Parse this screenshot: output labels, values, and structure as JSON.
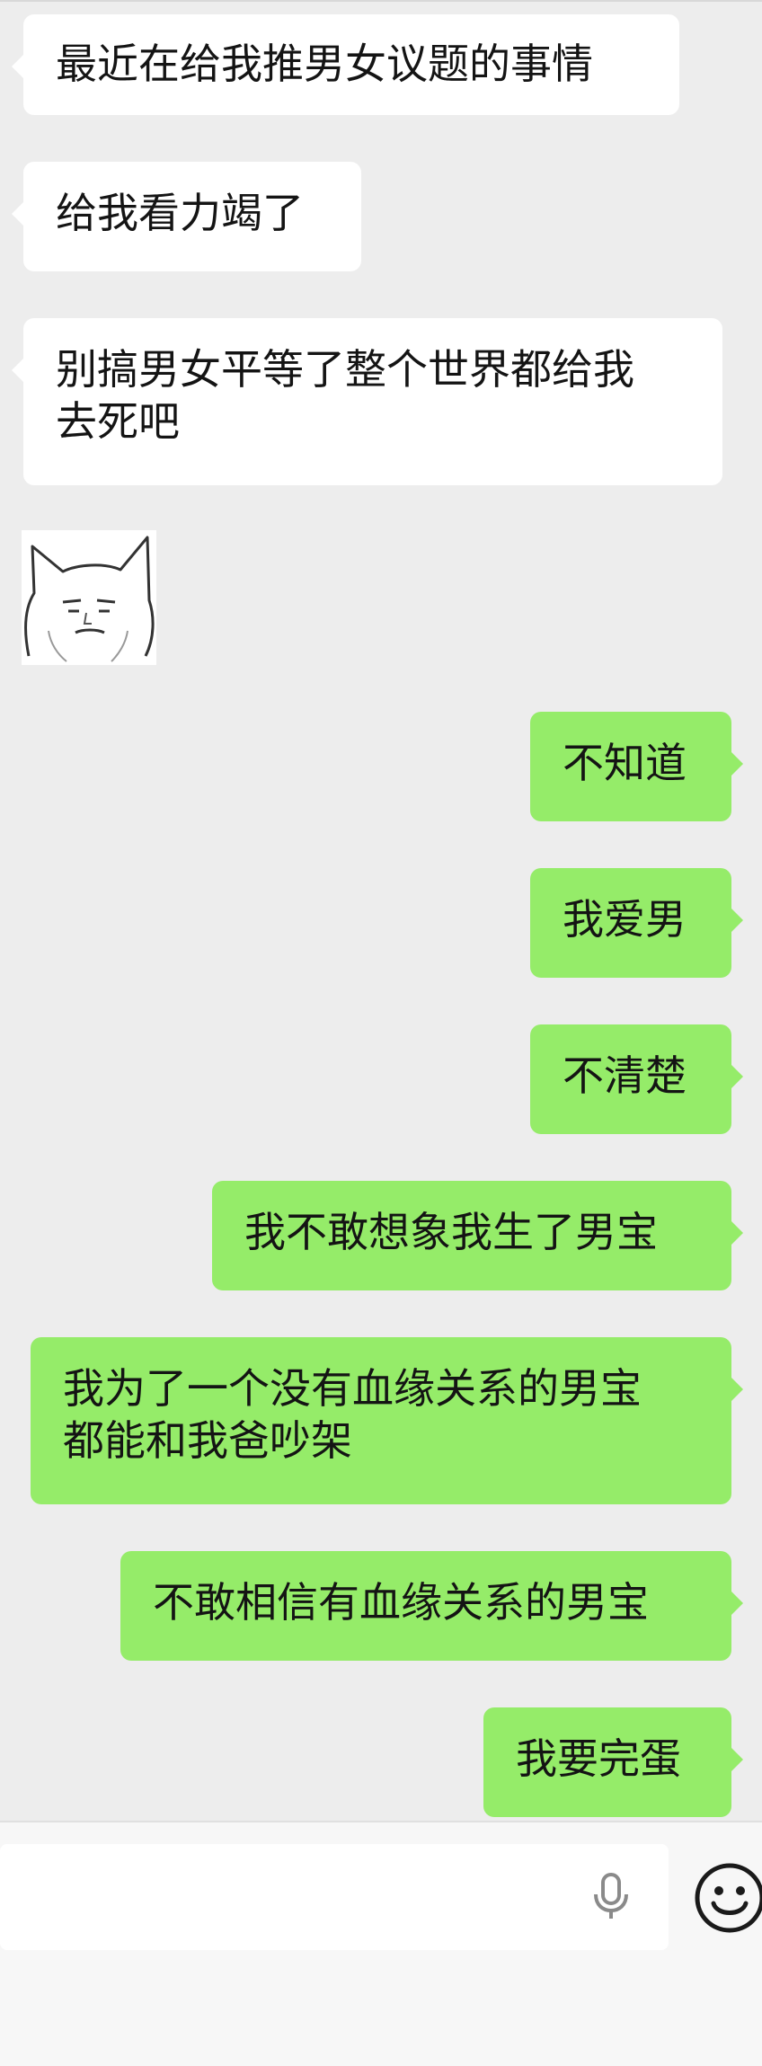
{
  "messages": [
    {
      "side": "left",
      "text": "最近在给我推男女议题的事情"
    },
    {
      "side": "left",
      "text": "给我看力竭了"
    },
    {
      "side": "left",
      "text": "别搞男女平等了整个世界都给我\n去死吧"
    },
    {
      "side": "left",
      "type": "sticker",
      "icon": "cat-face-sticker"
    },
    {
      "side": "right",
      "text": "不知道"
    },
    {
      "side": "right",
      "text": "我爱男"
    },
    {
      "side": "right",
      "text": "不清楚"
    },
    {
      "side": "right",
      "text": "我不敢想象我生了男宝"
    },
    {
      "side": "right",
      "text": "我为了一个没有血缘关系的男宝\n都能和我爸吵架"
    },
    {
      "side": "right",
      "text": "不敢相信有血缘关系的男宝"
    },
    {
      "side": "right",
      "text": "我要完蛋"
    }
  ],
  "input": {
    "value": "",
    "icons": [
      "microphone-icon",
      "emoji-icon"
    ]
  },
  "colors": {
    "background": "#ededed",
    "bubble_left": "#ffffff",
    "bubble_right": "#95ec69",
    "text": "#141414"
  }
}
